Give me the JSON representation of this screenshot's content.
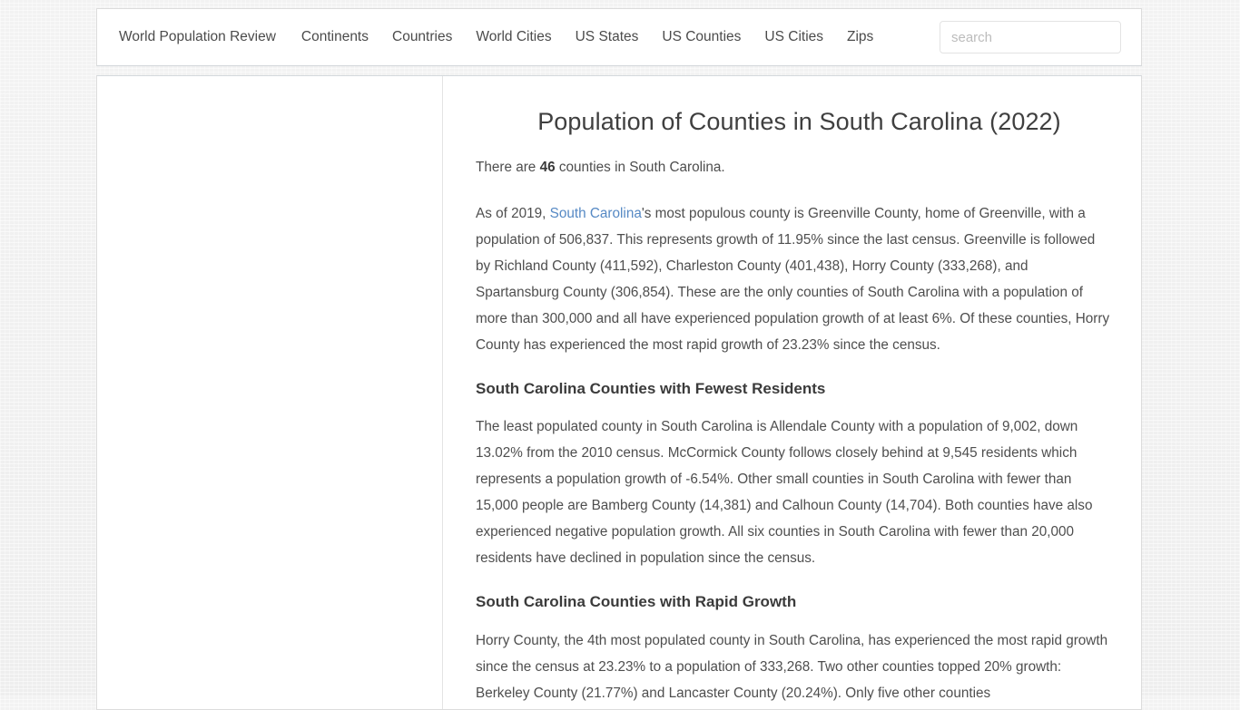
{
  "nav": {
    "items": [
      {
        "label": "World Population Review",
        "name": "nav-item-world-population-review"
      },
      {
        "label": "Continents",
        "name": "nav-item-continents"
      },
      {
        "label": "Countries",
        "name": "nav-item-countries"
      },
      {
        "label": "World Cities",
        "name": "nav-item-world-cities"
      },
      {
        "label": "US States",
        "name": "nav-item-us-states"
      },
      {
        "label": "US Counties",
        "name": "nav-item-us-counties"
      },
      {
        "label": "US Cities",
        "name": "nav-item-us-cities"
      },
      {
        "label": "Zips",
        "name": "nav-item-zips"
      }
    ]
  },
  "search": {
    "placeholder": "search",
    "value": ""
  },
  "main": {
    "title": "Population of Counties in South Carolina (2022)",
    "intro_before": "There are ",
    "intro_count": "46",
    "intro_after": " counties in South Carolina.",
    "p1_a": "As of 2019, ",
    "p1_link": "South Carolina",
    "p1_b": "'s most populous county is Greenville County, home of Greenville, with a population of 506,837. This represents growth of 11.95% since the last census. Greenville is followed by Richland County (411,592), Charleston County (401,438), Horry County (333,268), and Spartansburg County (306,854). These are the only counties of South Carolina with a population of more than 300,000 and all have experienced population growth of at least 6%. Of these counties, Horry County has experienced the most rapid growth of 23.23% since the census.",
    "h_fewest": "South Carolina Counties with Fewest Residents",
    "p2": "The least populated county in South Carolina is Allendale County with a population of 9,002, down 13.02% from the 2010 census. McCormick County follows closely behind at 9,545 residents which represents a population growth of -6.54%. Other small counties in South Carolina with fewer than 15,000 people are Bamberg County (14,381) and Calhoun County (14,704). Both counties have also experienced negative population growth. All six counties in South Carolina with fewer than 20,000 residents have declined in population since the census.",
    "h_rapid": "South Carolina Counties with Rapid Growth",
    "p3": "Horry County, the 4th most populated county in South Carolina, has experienced the most rapid growth since the census at 23.23% to a population of 333,268. Two other counties topped 20% growth: Berkeley County (21.77%) and Lancaster County (20.24%). Only five other counties"
  },
  "colors": {
    "link": "#5689c4",
    "text": "#4e4e4e",
    "heading": "#3b3b3b",
    "background": "#f1f1f1"
  }
}
